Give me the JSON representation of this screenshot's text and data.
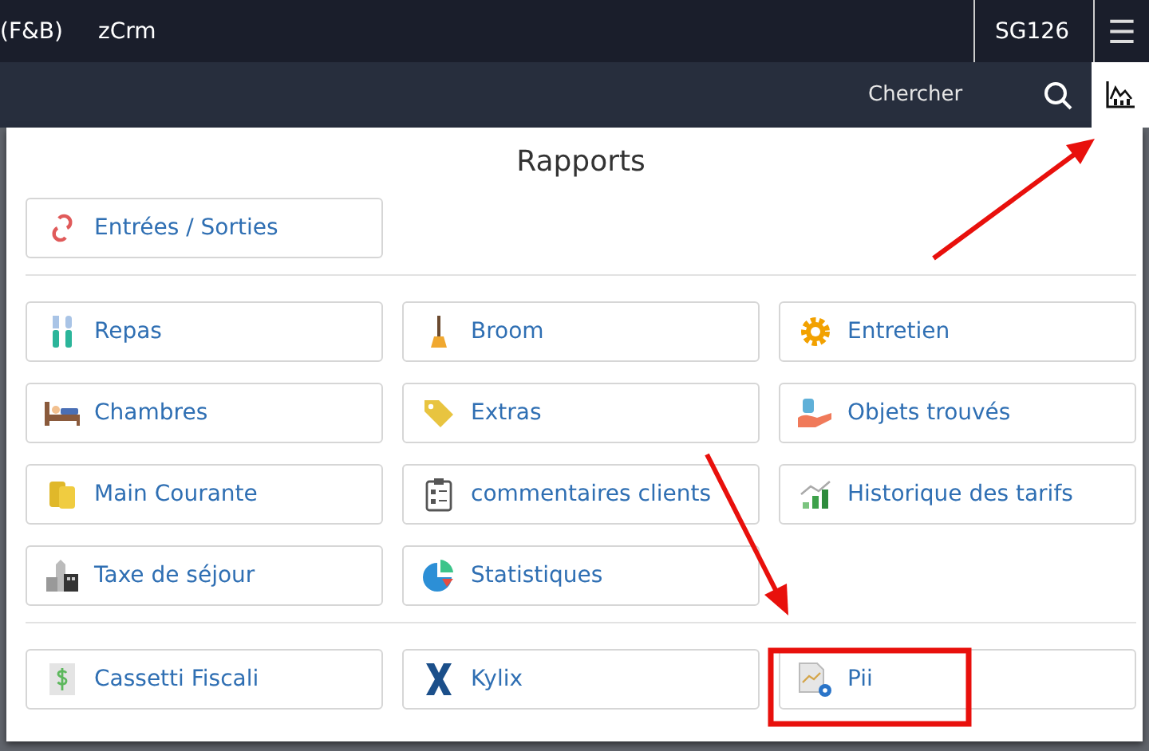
{
  "top_bar": {
    "left_items": [
      "(F&B)",
      "zCrm"
    ],
    "user": "SG126",
    "menu_icon": "☰"
  },
  "search_bar": {
    "placeholder": "Chercher"
  },
  "panel": {
    "title": "Rapports",
    "sections": [
      {
        "items": [
          "Entrées / Sorties"
        ]
      },
      {
        "items": [
          "Repas",
          "Broom",
          "Entretien",
          "Chambres",
          "Extras",
          "Objets trouvés",
          "Main Courante",
          "commentaires clients",
          "Historique des tarifs",
          "Taxe de séjour",
          "Statistiques"
        ]
      },
      {
        "items": [
          "Cassetti Fiscali",
          "Kylix",
          "Pii"
        ]
      }
    ]
  }
}
